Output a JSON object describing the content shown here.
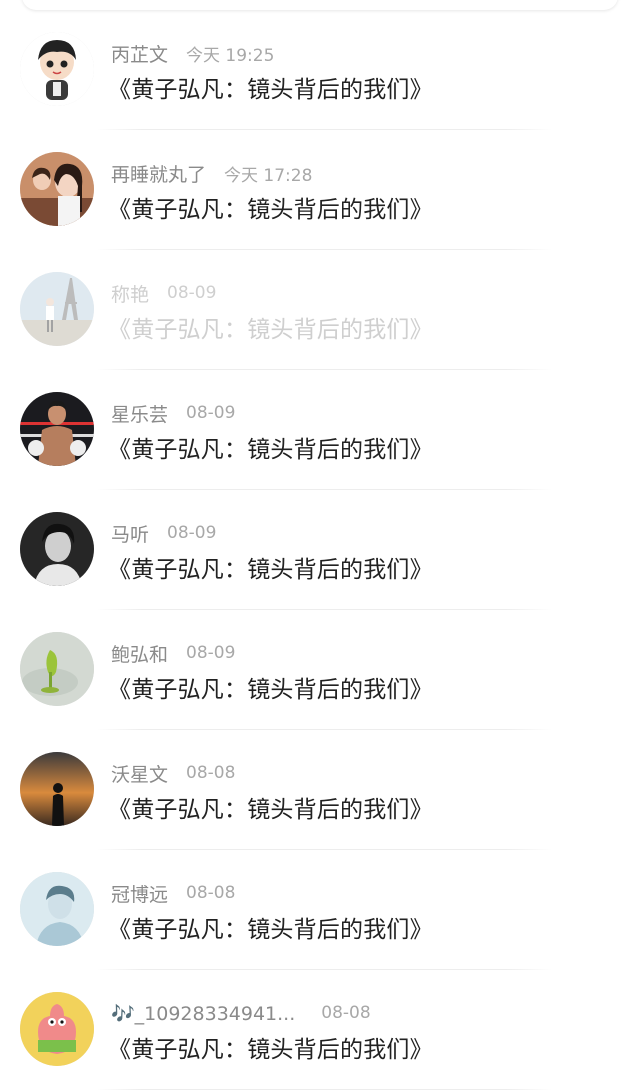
{
  "comments": [
    {
      "name": "丙芷文",
      "time": "今天 19:25",
      "text": "《黄子弘凡：镜头背后的我们》",
      "avatar_icon": "cartoon-boy-avatar",
      "dim": false
    },
    {
      "name": "再睡就丸了",
      "time": "今天 17:28",
      "text": "《黄子弘凡：镜头背后的我们》",
      "avatar_icon": "girl-photo-avatar",
      "dim": false
    },
    {
      "name": "称艳",
      "time": "08-09",
      "text": "《黄子弘凡：镜头背后的我们》",
      "avatar_icon": "eiffel-tower-avatar",
      "dim": true
    },
    {
      "name": "星乐芸",
      "time": "08-09",
      "text": "《黄子弘凡：镜头背后的我们》",
      "avatar_icon": "boxer-avatar",
      "dim": false
    },
    {
      "name": "马听",
      "time": "08-09",
      "text": "《黄子弘凡：镜头背后的我们》",
      "avatar_icon": "bw-portrait-avatar",
      "dim": false
    },
    {
      "name": "鲍弘和",
      "time": "08-09",
      "text": "《黄子弘凡：镜头背后的我们》",
      "avatar_icon": "green-drink-avatar",
      "dim": false
    },
    {
      "name": "沃星文",
      "time": "08-08",
      "text": "《黄子弘凡：镜头背后的我们》",
      "avatar_icon": "sunset-silhouette-avatar",
      "dim": false
    },
    {
      "name": "冠博远",
      "time": "08-08",
      "text": "《黄子弘凡：镜头背后的我们》",
      "avatar_icon": "blue-portrait-avatar",
      "dim": false
    },
    {
      "name": "🎶_10928334941...",
      "time": "08-08",
      "text": "《黄子弘凡：镜头背后的我们》",
      "avatar_icon": "patrick-star-avatar",
      "dim": false
    }
  ]
}
